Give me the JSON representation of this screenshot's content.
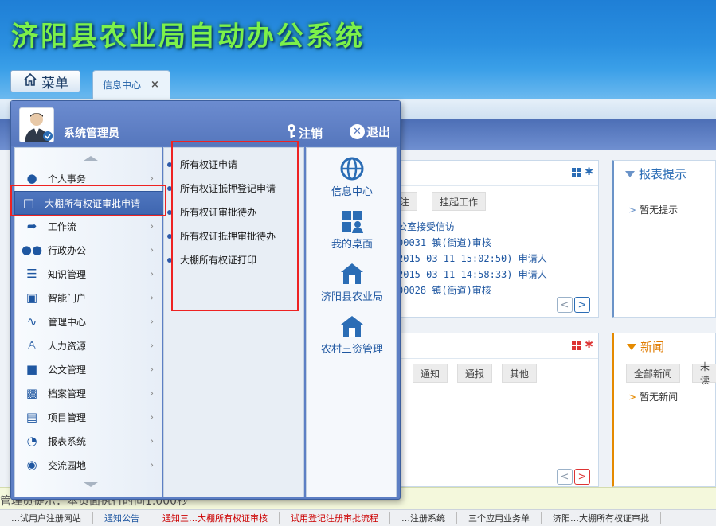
{
  "app": {
    "title": "济阳县农业局自动办公系统"
  },
  "menu_button": {
    "label": "菜单"
  },
  "tab": {
    "label": "信息中心",
    "close": "×"
  },
  "user": {
    "name": "系统管理员"
  },
  "actions": {
    "logout": "注销",
    "exit": "退出"
  },
  "left_menu": [
    {
      "label": "个人事务",
      "icon": "person-icon"
    },
    {
      "label": "大棚所有权证审批申请",
      "icon": "document-icon",
      "selected": true
    },
    {
      "label": "工作流",
      "icon": "workflow-icon"
    },
    {
      "label": "行政办公",
      "icon": "group-icon"
    },
    {
      "label": "知识管理",
      "icon": "knowledge-icon"
    },
    {
      "label": "智能门户",
      "icon": "portal-icon"
    },
    {
      "label": "管理中心",
      "icon": "chart-line-icon"
    },
    {
      "label": "人力资源",
      "icon": "hr-icon"
    },
    {
      "label": "公文管理",
      "icon": "folder-icon"
    },
    {
      "label": "档案管理",
      "icon": "archive-icon"
    },
    {
      "label": "项目管理",
      "icon": "project-icon"
    },
    {
      "label": "报表系统",
      "icon": "pie-chart-icon"
    },
    {
      "label": "交流园地",
      "icon": "chat-icon"
    }
  ],
  "sub_menu": [
    {
      "label": "所有权证申请"
    },
    {
      "label": "所有权证抵押登记申请"
    },
    {
      "label": "所有权证审批待办"
    },
    {
      "label": "所有权证抵押审批待办"
    },
    {
      "label": "大棚所有权证打印"
    }
  ],
  "quick_links": [
    {
      "label": "信息中心",
      "icon": "globe-icon"
    },
    {
      "label": "我的桌面",
      "icon": "desktop-icon"
    },
    {
      "label": "济阳县农业局",
      "icon": "home-icon"
    },
    {
      "label": "农村三资管理",
      "icon": "home-icon"
    }
  ],
  "panel_work": {
    "buttons": [
      "注",
      "挂起工作"
    ],
    "items": [
      "公室接受信访",
      "00031 镇(街道)审核",
      "2015-03-11 15:02:50) 申请人",
      "2015-03-11 14:58:33) 申请人",
      "00028 镇(街道)审核"
    ],
    "prev": "<",
    "next": ">"
  },
  "panel_notice": {
    "buttons": [
      "通知",
      "通报",
      "其他"
    ],
    "prev": "<",
    "next": ">"
  },
  "panel_report": {
    "title": "报表提示",
    "item": "暂无提示"
  },
  "panel_news": {
    "title": "新闻",
    "buttons": [
      "全部新闻",
      "未读"
    ],
    "item": "暂无新闻"
  },
  "status": {
    "text": "管理员提示：本页面执行时间1.000秒"
  },
  "footer": [
    {
      "text": "…试用户注册网站",
      "color": "normal"
    },
    {
      "text": "通知公告",
      "color": "blue"
    },
    {
      "text": "通知三…大棚所有权证审核",
      "color": "red"
    },
    {
      "text": "试用登记注册审批流程",
      "color": "red"
    },
    {
      "text": "…注册系统",
      "color": "normal"
    },
    {
      "text": "三个应用业务单",
      "color": "normal"
    },
    {
      "text": "济阳…大棚所有权证审批",
      "color": "normal"
    }
  ],
  "colors": {
    "title_green": "#7cf14a",
    "header_blue": "#2a8fe0",
    "menu_bg": "#5d7fc4",
    "highlight_red": "#ee2222",
    "news_orange": "#e58a00"
  }
}
